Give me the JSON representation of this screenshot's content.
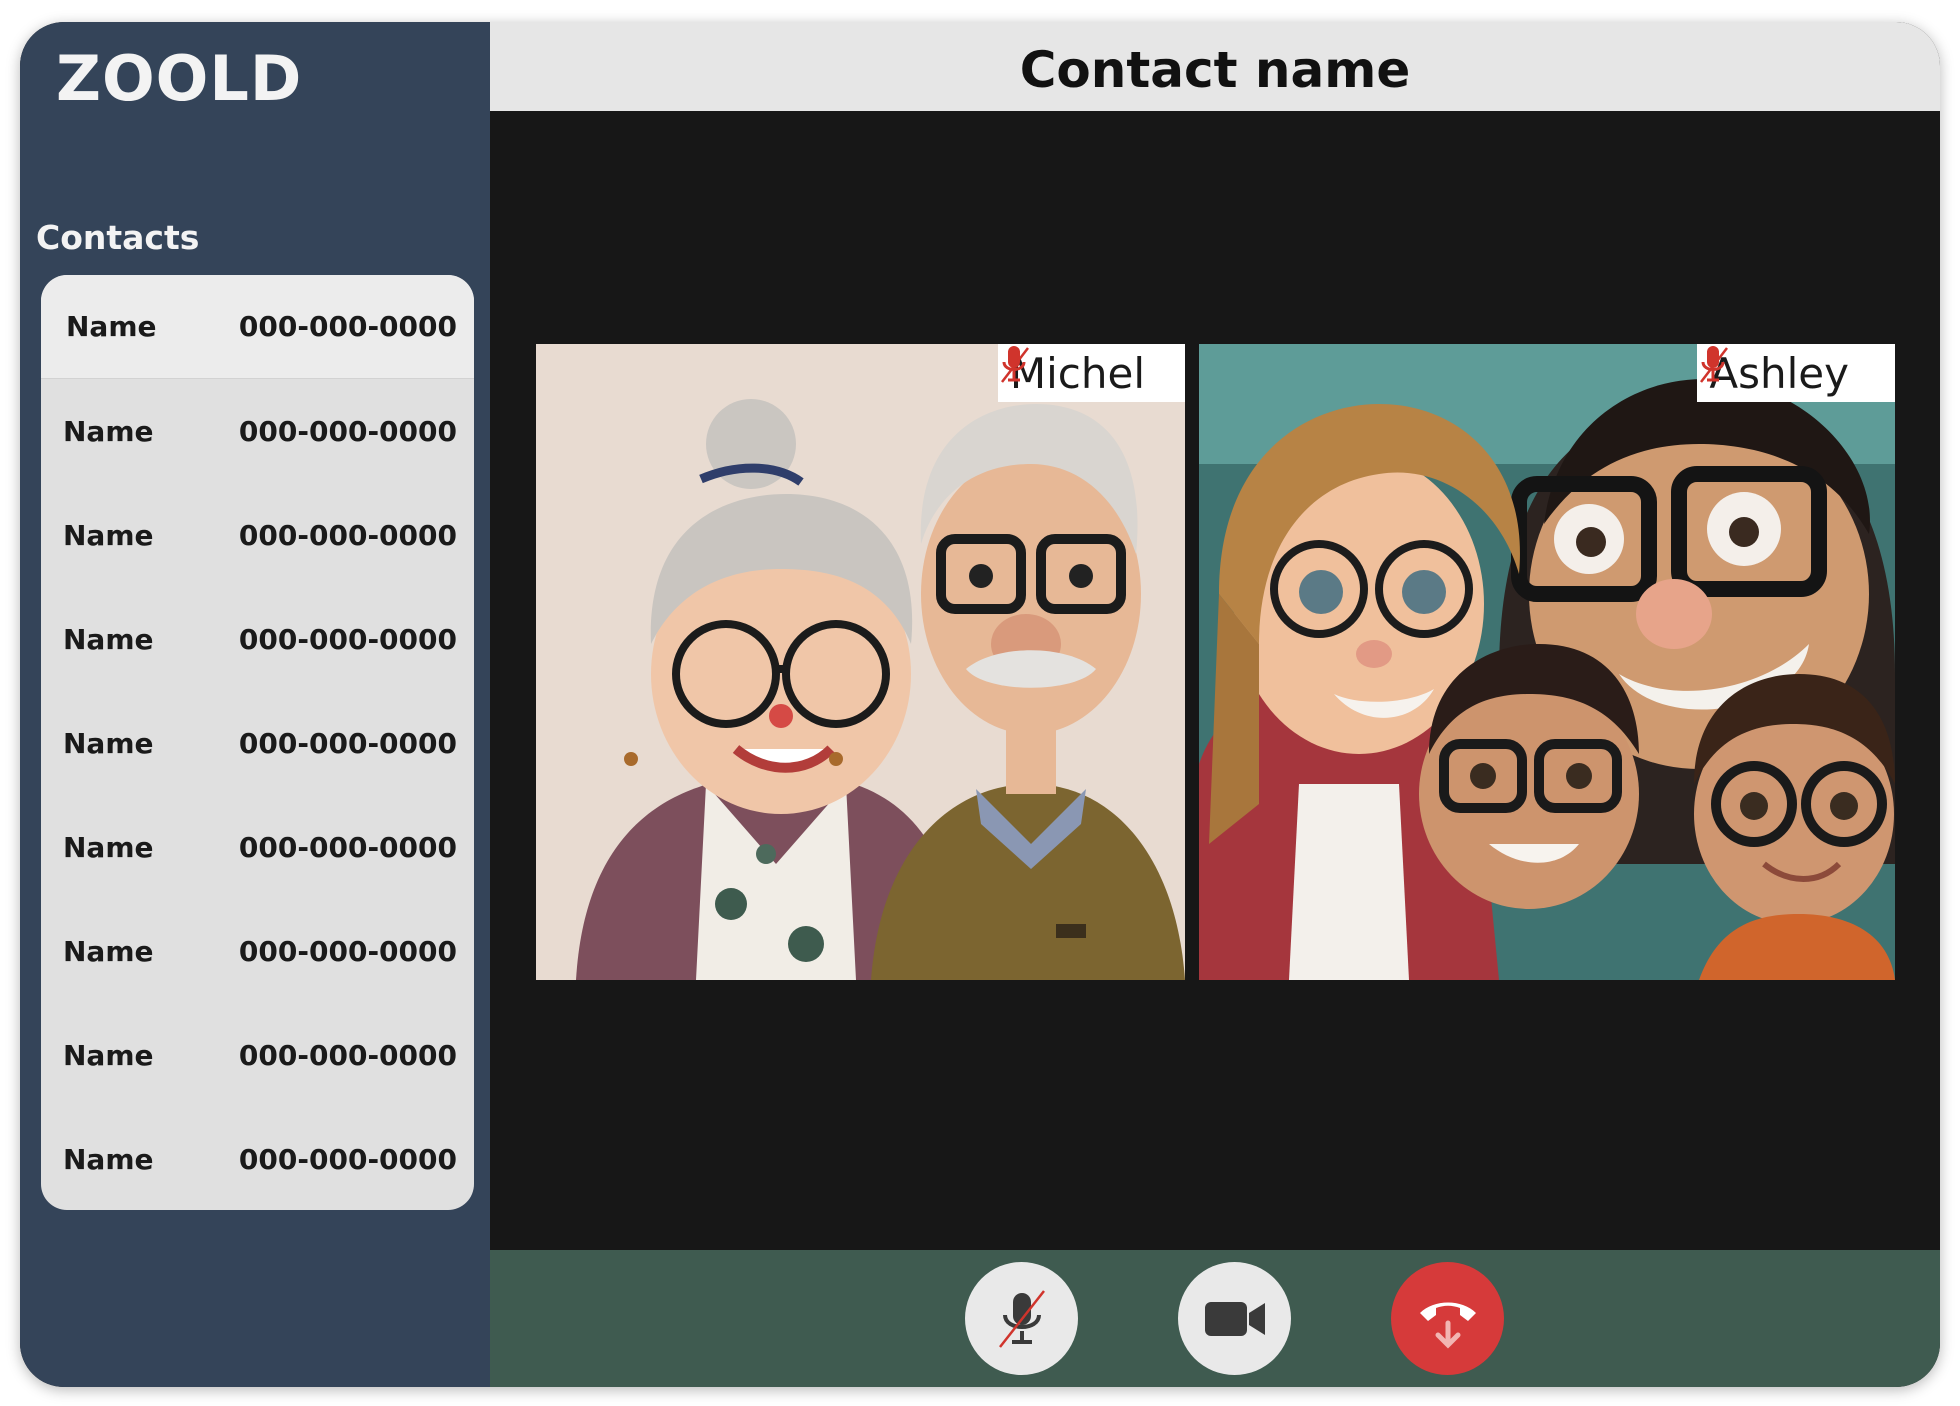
{
  "app": {
    "logo": "ZOOLD",
    "contacts_heading": "Contacts"
  },
  "contacts": [
    {
      "name": "Name",
      "phone": "000-000-0000"
    },
    {
      "name": "Name",
      "phone": "000-000-0000"
    },
    {
      "name": "Name",
      "phone": "000-000-0000"
    },
    {
      "name": "Name",
      "phone": "000-000-0000"
    },
    {
      "name": "Name",
      "phone": "000-000-0000"
    },
    {
      "name": "Name",
      "phone": "000-000-0000"
    },
    {
      "name": "Name",
      "phone": "000-000-0000"
    },
    {
      "name": "Name",
      "phone": "000-000-0000"
    },
    {
      "name": "Name",
      "phone": "000-000-0000"
    }
  ],
  "call": {
    "title": "Contact name",
    "participants": [
      {
        "name": "Michel",
        "muted": true,
        "icon": "mic-off-icon"
      },
      {
        "name": "Ashley",
        "muted": true,
        "icon": "mic-off-icon"
      }
    ]
  },
  "controls": {
    "mic_icon": "mic-off-icon",
    "video_icon": "video-camera-icon",
    "end_icon": "hang-up-icon"
  },
  "colors": {
    "sidebar": "#344459",
    "contact_list": "#e0e0e0",
    "header": "#e6e6e6",
    "stage": "#171717",
    "control_bar": "#3f5b50",
    "end_call": "#d63a3a",
    "muted_icon": "#d0342c"
  }
}
